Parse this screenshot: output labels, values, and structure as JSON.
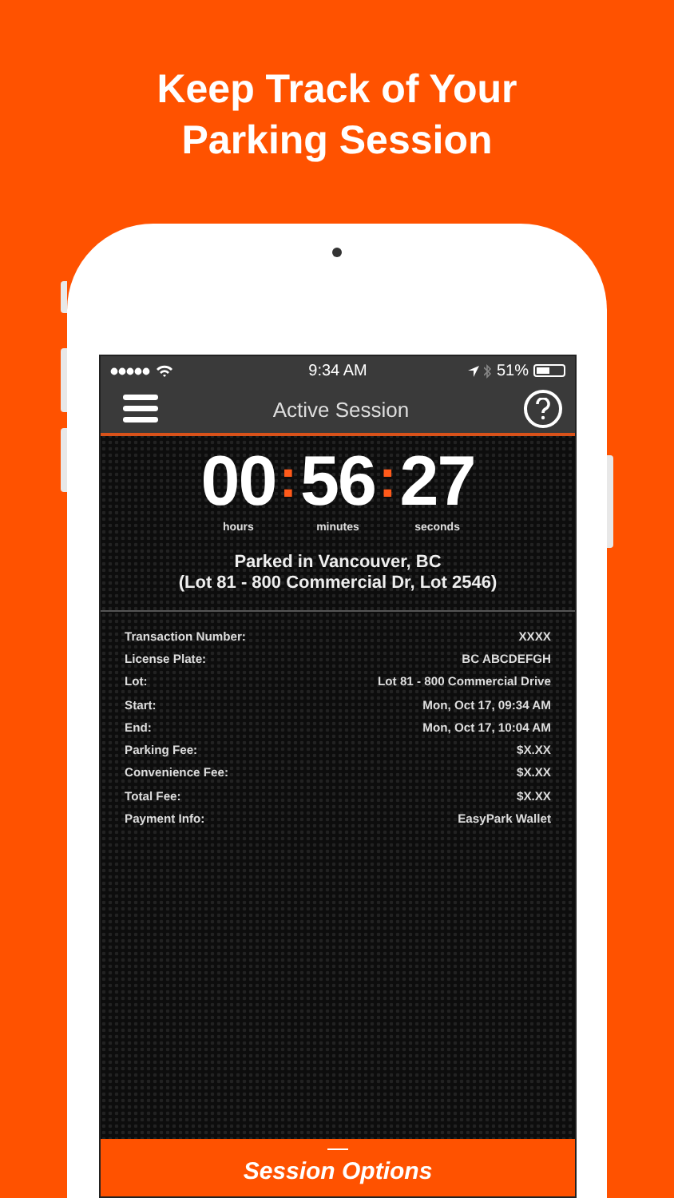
{
  "headline": "Keep Track of Your Parking Session",
  "status_bar": {
    "time": "9:34 AM",
    "battery": "51%"
  },
  "nav": {
    "title": "Active Session"
  },
  "timer": {
    "units": [
      {
        "value": "00",
        "label": "hours"
      },
      {
        "value": "56",
        "label": "minutes"
      },
      {
        "value": "27",
        "label": "seconds"
      }
    ],
    "separator": ":"
  },
  "location": {
    "line_1": "Parked in Vancouver, BC",
    "line_2": "(Lot 81 - 800 Commercial Dr, Lot 2546)"
  },
  "details": [
    {
      "label": "Transaction Number:",
      "value": "XXXX"
    },
    {
      "label": "License Plate:",
      "value": "BC ABCDEFGH"
    },
    {
      "label": "Lot:",
      "value": "Lot 81  - 800 Commercial Drive"
    },
    {
      "label": "Start:",
      "value": "Mon, Oct 17, 09:34 AM"
    },
    {
      "label": "End:",
      "value": "Mon, Oct 17, 10:04 AM"
    },
    {
      "label": "Parking Fee:",
      "value": "$X.XX"
    },
    {
      "label": "Convenience Fee:",
      "value": "$X.XX"
    },
    {
      "label": "Total Fee:",
      "value": "$X.XX"
    },
    {
      "label": "Payment Info:",
      "value": "EasyPark Wallet"
    }
  ],
  "bottom_button": {
    "label": "Session Options"
  }
}
